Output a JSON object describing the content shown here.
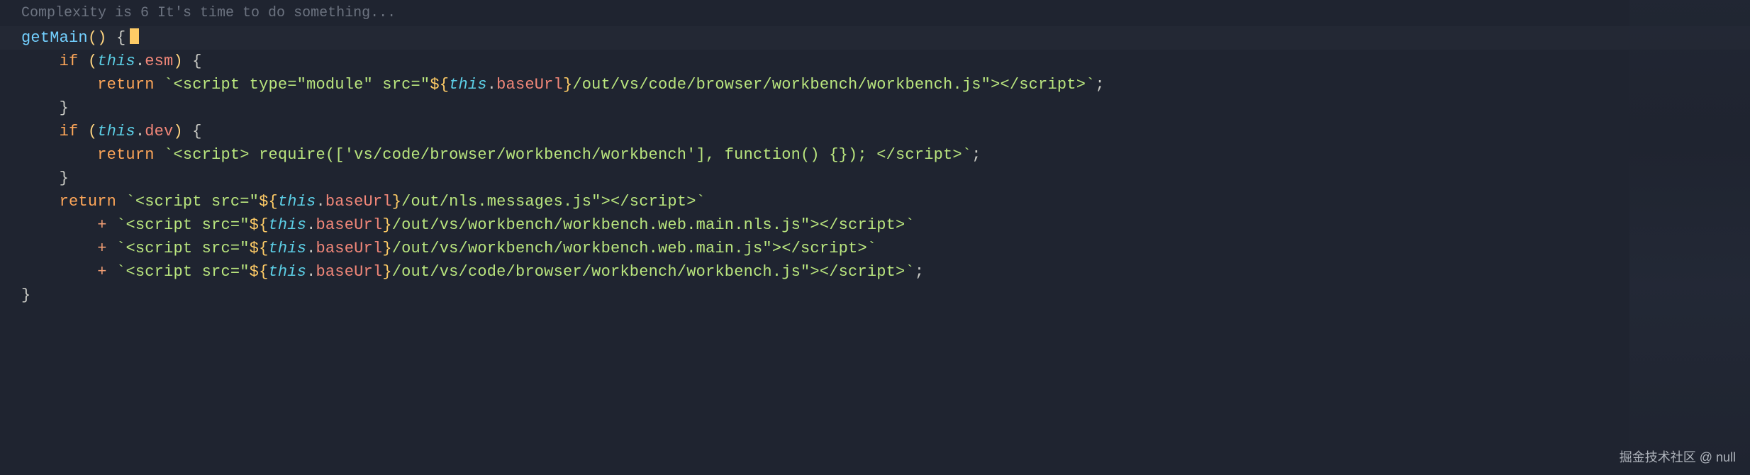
{
  "complexity_hint": "Complexity is 6 It's time to do something...",
  "fn": {
    "name": "getMain",
    "parens": "()",
    "open": "{",
    "close": "}"
  },
  "l2": {
    "if": "if",
    "op": "(",
    "this": "this",
    "dot": ".",
    "prop": "esm",
    "cp": ")",
    "ob": "{"
  },
  "l3": {
    "ret": "return",
    "bt": "`",
    "s1": "<script type=\"module\" src=\"",
    "io": "${",
    "this": "this",
    "dot": ".",
    "prop": "baseUrl",
    "ic": "}",
    "s2": "/out/vs/code/browser/workbench/workbench.js\"></script>",
    "bt2": "`",
    "semi": ";"
  },
  "l4": {
    "cb": "}"
  },
  "l5": {
    "if": "if",
    "op": "(",
    "this": "this",
    "dot": ".",
    "prop": "dev",
    "cp": ")",
    "ob": "{"
  },
  "l6": {
    "ret": "return",
    "bt": "`",
    "s": "<script> require(['vs/code/browser/workbench/workbench'], function() {}); </script>",
    "bt2": "`",
    "semi": ";"
  },
  "l7": {
    "cb": "}"
  },
  "l8": {
    "ret": "return",
    "bt": "`",
    "s1": "<script src=\"",
    "io": "${",
    "this": "this",
    "dot": ".",
    "prop": "baseUrl",
    "ic": "}",
    "s2": "/out/nls.messages.js\"></script>",
    "bt2": "`"
  },
  "l9": {
    "plus": "+",
    "bt": "`",
    "s1": "<script src=\"",
    "io": "${",
    "this": "this",
    "dot": ".",
    "prop": "baseUrl",
    "ic": "}",
    "s2": "/out/vs/workbench/workbench.web.main.nls.js\"></script>",
    "bt2": "`"
  },
  "l10": {
    "plus": "+",
    "bt": "`",
    "s1": "<script src=\"",
    "io": "${",
    "this": "this",
    "dot": ".",
    "prop": "baseUrl",
    "ic": "}",
    "s2": "/out/vs/workbench/workbench.web.main.js\"></script>",
    "bt2": "`"
  },
  "l11": {
    "plus": "+",
    "bt": "`",
    "s1": "<script src=\"",
    "io": "${",
    "this": "this",
    "dot": ".",
    "prop": "baseUrl",
    "ic": "}",
    "s2": "/out/vs/code/browser/workbench/workbench.js\"></script>",
    "bt2": "`",
    "semi": ";"
  },
  "watermark": "掘金技术社区 @ null"
}
